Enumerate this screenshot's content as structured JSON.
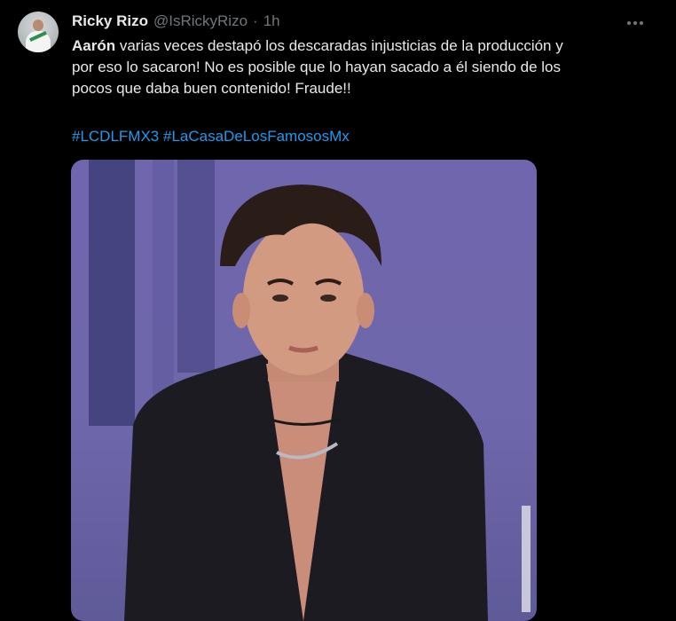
{
  "tweet": {
    "author_name": "Ricky Rizo",
    "author_handle": "@IsRickyRizo",
    "separator": "·",
    "timestamp": "1h",
    "text_lines": [
      {
        "bold": "Aarón",
        "rest": " varias veces destapó los descaradas injusticias de la producción y"
      },
      {
        "bold": "",
        "rest": "por eso lo sacaron! No es posible que lo hayan sacado a él siendo de los"
      },
      {
        "bold": "",
        "rest": "pocos que daba buen contenido! Fraude!!"
      }
    ],
    "hashtags": [
      "#LCDLFMX3",
      "#LaCasaDeLosFamososMx"
    ]
  },
  "icons": {
    "more": "more-horizontal-icon"
  },
  "colors": {
    "background": "#000000",
    "text": "#e7e9ea",
    "muted": "#71767b",
    "link": "#1d9bf0",
    "media_bg": "#6f66ad"
  }
}
